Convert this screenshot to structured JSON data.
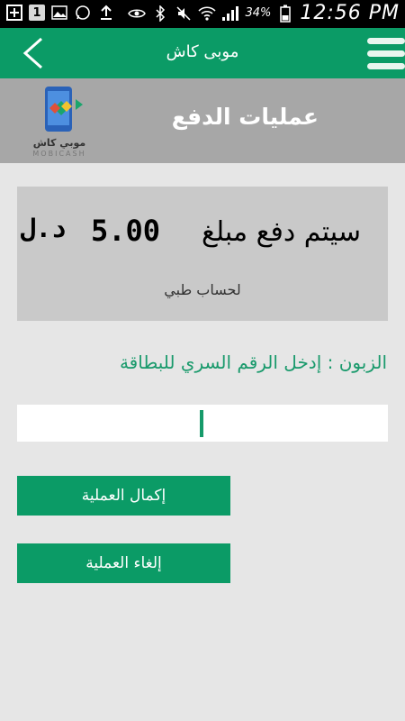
{
  "status_bar": {
    "notification_count": "1",
    "battery_pct": "34%",
    "time": "12:56 PM"
  },
  "header": {
    "title": "موبى كاش"
  },
  "sub_header": {
    "title": "عمليات الدفع",
    "logo_text_ar": "موبي كاش",
    "logo_text_en": "MOBICASH"
  },
  "payment": {
    "label": "سيتم دفع مبلغ",
    "amount": "5.00",
    "currency": "د.ل",
    "account": "لحساب طبي"
  },
  "pin": {
    "prompt": "الزبون : إدخل الرقم السري للبطاقة",
    "value": ""
  },
  "buttons": {
    "complete": "إكمال العملية",
    "cancel": "إلغاء العملية"
  },
  "colors": {
    "brand_green": "#0b9b66",
    "header_gray": "#a7a7a7",
    "background": "#e6e6e6"
  }
}
